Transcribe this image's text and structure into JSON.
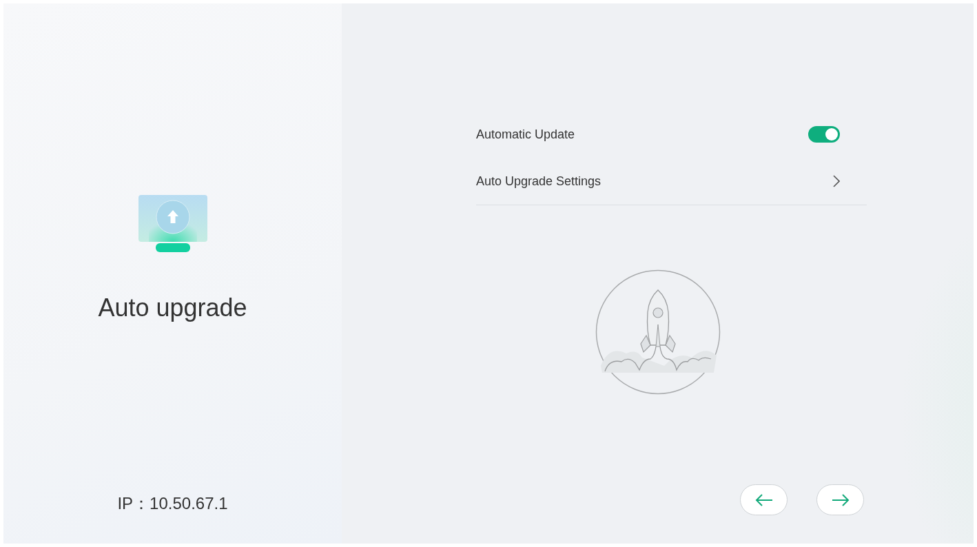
{
  "sidebar": {
    "title": "Auto upgrade",
    "ip": "IP：10.50.67.1"
  },
  "settings": [
    {
      "kind": "toggle",
      "label": "Automatic Update",
      "on": true
    },
    {
      "kind": "link",
      "label": "Auto Upgrade Settings"
    }
  ]
}
